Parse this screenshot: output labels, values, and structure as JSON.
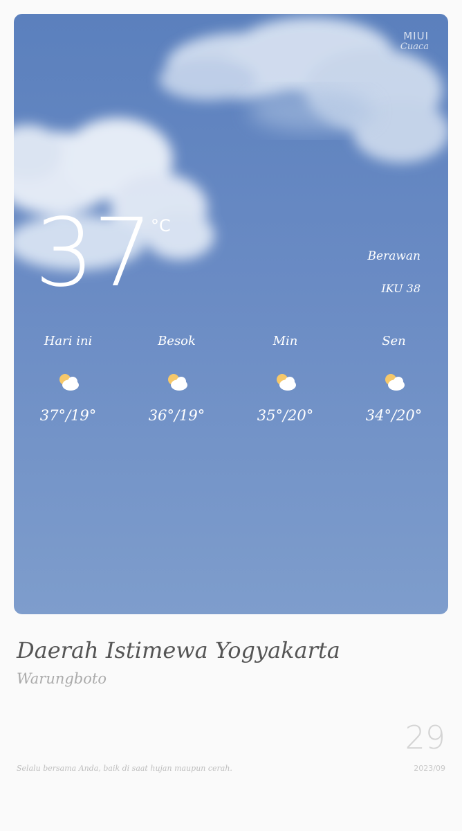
{
  "brand": {
    "name": "MIUI",
    "app": "Cuaca"
  },
  "current": {
    "temperature": "37",
    "unit": "°C",
    "condition": "Berawan",
    "aqi": "IKU 38"
  },
  "forecast": [
    {
      "day": "Hari ini",
      "icon": "partly-cloudy-icon",
      "range": "37°/19°"
    },
    {
      "day": "Besok",
      "icon": "partly-cloudy-icon",
      "range": "36°/19°"
    },
    {
      "day": "Min",
      "icon": "partly-cloudy-icon",
      "range": "35°/20°"
    },
    {
      "day": "Sen",
      "icon": "partly-cloudy-icon",
      "range": "34°/20°"
    }
  ],
  "location": {
    "region": "Daerah Istimewa Yogyakarta",
    "locality": "Warungboto"
  },
  "footer": {
    "slogan": "Selalu bersama Anda, baik di saat hujan maupun cerah.",
    "day": "29",
    "year_month": "2023/09"
  },
  "colors": {
    "sky_top": "#5b80bd",
    "sky_bottom": "#7e9dcc",
    "sun": "#f6c86a",
    "cloud": "#ffffff"
  }
}
